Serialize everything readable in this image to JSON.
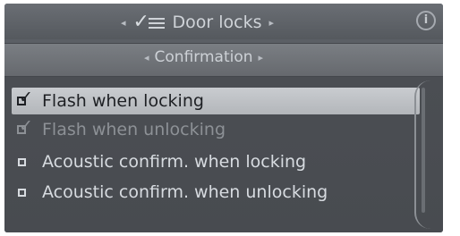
{
  "header": {
    "title": "Door locks",
    "icon": "checklist-menu-icon",
    "info_icon_glyph": "i"
  },
  "subheader": {
    "title": "Confirmation"
  },
  "options": [
    {
      "label": "Flash when locking",
      "checked": true,
      "state": "selected"
    },
    {
      "label": "Flash when unlocking",
      "checked": true,
      "state": "disabled"
    },
    {
      "label": "Acoustic confirm. when locking",
      "checked": false,
      "state": "normal"
    },
    {
      "label": "Acoustic confirm. when unlocking",
      "checked": false,
      "state": "normal"
    }
  ],
  "colors": {
    "panel": "#55595f",
    "highlight": "#c0c3c7",
    "text": "#d7dbe0",
    "disabled_text": "#8d9196"
  }
}
